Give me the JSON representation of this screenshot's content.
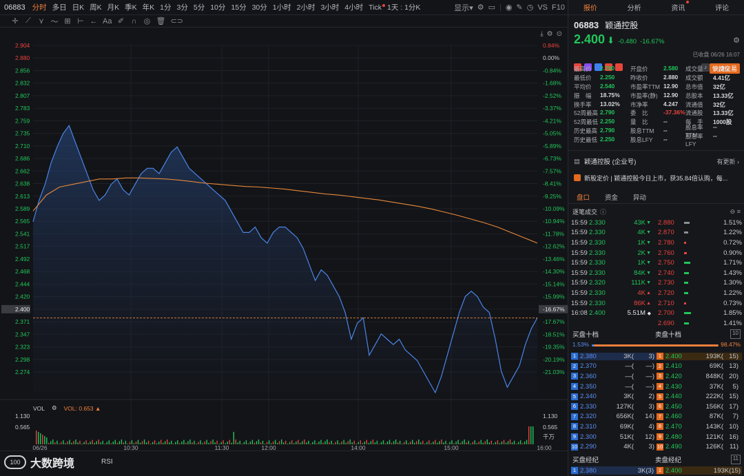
{
  "toolbar": {
    "code": "06883",
    "periods": [
      "分时",
      "多日",
      "日K",
      "周K",
      "月K",
      "季K",
      "年K",
      "1分",
      "3分",
      "5分",
      "10分",
      "15分",
      "30分",
      "1小时",
      "2小时",
      "3小时",
      "4小时",
      "Tick",
      "1天 : 1分K"
    ],
    "active_period": "分时",
    "display_label": "显示",
    "vs_label": "VS",
    "f10_label": "F10",
    "drop_arrow": "▾"
  },
  "chart_data": {
    "type": "line",
    "y_price_ticks": [
      "2.904",
      "2.880",
      "2.856",
      "2.832",
      "2.807",
      "2.783",
      "2.759",
      "2.735",
      "2.710",
      "2.686",
      "2.662",
      "2.638",
      "2.613",
      "2.589",
      "2.565",
      "2.541",
      "2.517",
      "2.492",
      "2.468",
      "2.444",
      "2.420",
      "2.400",
      "2.371",
      "2.347",
      "2.323",
      "2.298",
      "2.274"
    ],
    "y_pct_ticks": [
      "0.84%",
      "0.00%",
      "-0.84%",
      "-1.68%",
      "-2.52%",
      "-3.37%",
      "-4.21%",
      "-5.05%",
      "-5.89%",
      "-6.73%",
      "-7.57%",
      "-8.41%",
      "-9.25%",
      "-10.09%",
      "-10.94%",
      "-11.78%",
      "-12.62%",
      "-13.46%",
      "-14.30%",
      "-15.14%",
      "-15.99%",
      "-16.67%",
      "-17.67%",
      "-18.51%",
      "-19.35%",
      "-20.19%",
      "-21.03%"
    ],
    "ylim": [
      2.26,
      2.91
    ],
    "prev_close": 2.88,
    "last_price": 2.4,
    "x_labels": [
      "06/26",
      "10:30",
      "11:30",
      "12:00",
      "14:00",
      "15:00",
      "16:00"
    ],
    "series": [
      {
        "values": [
          2.58,
          2.62,
          2.65,
          2.69,
          2.72,
          2.745,
          2.76,
          2.73,
          2.7,
          2.67,
          2.64,
          2.62,
          2.63,
          2.65,
          2.66,
          2.64,
          2.63,
          2.65,
          2.67,
          2.68,
          2.68,
          2.67,
          2.69,
          2.71,
          2.72,
          2.7,
          2.68,
          2.67,
          2.66,
          2.65,
          2.64,
          2.63,
          2.62,
          2.6,
          2.58,
          2.56,
          2.56,
          2.57,
          2.55,
          2.54,
          2.56,
          2.57,
          2.57,
          2.56,
          2.55,
          2.53,
          2.5,
          2.47,
          2.49,
          2.48,
          2.46,
          2.44,
          2.41,
          2.36,
          2.39,
          2.4,
          2.33,
          2.35,
          2.37,
          2.36,
          2.35,
          2.36,
          2.34,
          2.33,
          2.32,
          2.3,
          2.28,
          2.26,
          2.29,
          2.33,
          2.37,
          2.41,
          2.44,
          2.45,
          2.44,
          2.42,
          2.41,
          2.36,
          2.3,
          2.27,
          2.29,
          2.31,
          2.35,
          2.38,
          2.4
        ]
      },
      {
        "values": [
          2.6,
          2.63,
          2.645,
          2.65,
          2.655,
          2.66,
          2.66,
          2.662,
          2.662,
          2.661,
          2.66,
          2.658,
          2.655,
          2.652,
          2.65,
          2.648,
          2.646,
          2.645,
          2.643,
          2.641,
          2.638,
          2.635,
          2.632,
          2.63,
          2.627,
          2.624,
          2.621,
          2.617,
          2.613,
          2.609,
          2.604,
          2.598,
          2.592,
          2.585,
          2.578,
          2.57,
          2.56,
          2.55,
          2.54
        ]
      }
    ],
    "vol_ticks": [
      "1.130",
      "0.565"
    ],
    "vol_unit": "千万"
  },
  "toolbar2_icons": [
    "crosshair-icon",
    "line-tool-icon",
    "fork-icon",
    "wave-icon",
    "pattern-icon",
    "measure-icon",
    "arrow-icon",
    "text-icon",
    "brush-icon",
    "magnet-icon",
    "eye-icon",
    "delete-icon",
    "capsule-icon"
  ],
  "chart_overlay": {
    "fit_icon": "⤓",
    "gear": "⚙",
    "zoom": "⊙"
  },
  "vol_legend": {
    "label": "VOL",
    "value": "VOL: 0.653",
    "arrow": "▲",
    "gear": "⚙"
  },
  "rsi": {
    "label": "RSI",
    "logo": "大数跨境"
  },
  "panel": {
    "tabs": [
      "报价",
      "分析",
      "资讯",
      "评论"
    ],
    "active_tab": "报价",
    "code": "06883",
    "name": "颖通控股",
    "price": "2.400",
    "arrow": "⬇",
    "change": "-0.480",
    "change_pct": "-16.67%",
    "closed": "已收盘 06/26 16:07",
    "fast_trade": "快捷交易",
    "badge_colors": [
      "#e9443c",
      "#8a4cf0",
      "#3f7ef0",
      "#e9443c",
      "#e9443c"
    ],
    "stats": [
      [
        [
          "最高价",
          "2.790",
          "g"
        ],
        [
          "开盘价",
          "2.580",
          "g"
        ],
        [
          "成交量",
          "1.74亿",
          ""
        ]
      ],
      [
        [
          "最低价",
          "2.250",
          "g"
        ],
        [
          "昨收价",
          "2.880",
          ""
        ],
        [
          "成交额",
          "4.41亿",
          ""
        ]
      ],
      [
        [
          "平均价",
          "2.540",
          "g"
        ],
        [
          "市盈率TTM",
          "12.90",
          ""
        ],
        [
          "总市值",
          "32亿",
          ""
        ]
      ],
      [
        [
          "振　幅",
          "18.75%",
          ""
        ],
        [
          "市盈率(静)",
          "12.90",
          ""
        ],
        [
          "总股本",
          "13.33亿",
          ""
        ]
      ],
      [
        [
          "换手率",
          "13.02%",
          ""
        ],
        [
          "市净率",
          "4.247",
          ""
        ],
        [
          "流通值",
          "32亿",
          ""
        ]
      ],
      [
        [
          "52周最高",
          "2.790",
          "g"
        ],
        [
          "委　比",
          "-37.36%",
          "r"
        ],
        [
          "流通股",
          "13.33亿",
          ""
        ]
      ],
      [
        [
          "52周最低",
          "2.250",
          "g"
        ],
        [
          "量　比",
          "--",
          ""
        ],
        [
          "每　手",
          "1000股",
          ""
        ]
      ],
      [
        [
          "历史最高",
          "2.790",
          "g"
        ],
        [
          "股息TTM",
          "--",
          ""
        ],
        [
          "股息率TTM",
          "--",
          ""
        ]
      ],
      [
        [
          "历史最低",
          "2.250",
          "g"
        ],
        [
          "股息LFY",
          "--",
          ""
        ],
        [
          "股息率LFY",
          "--",
          ""
        ]
      ]
    ],
    "news1": {
      "text": "颖通控股 (企业号)",
      "more": "有更新 ›"
    },
    "news2": {
      "text": "新股定价 | 颖通控股今日上市，获35.84倍认购，每..."
    },
    "subtabs": [
      "盘口",
      "资金",
      "异动"
    ],
    "tick_head": "逐笔成交",
    "ticks": [
      [
        "15:59",
        "2.330",
        "43K",
        "▼",
        "#21c65a"
      ],
      [
        "15:59",
        "2.330",
        "4K",
        "▼",
        "#21c65a"
      ],
      [
        "15:59",
        "2.330",
        "1K",
        "▼",
        "#21c65a"
      ],
      [
        "15:59",
        "2.330",
        "2K",
        "▼",
        "#21c65a"
      ],
      [
        "15:59",
        "2.330",
        "1K",
        "▼",
        "#21c65a"
      ],
      [
        "15:59",
        "2.330",
        "84K",
        "▼",
        "#21c65a"
      ],
      [
        "15:59",
        "2.320",
        "111K",
        "▼",
        "#21c65a"
      ],
      [
        "15:59",
        "2.330",
        "4K",
        "▲",
        "#e9443c"
      ],
      [
        "15:59",
        "2.330",
        "86K",
        "▲",
        "#e9443c"
      ],
      [
        "16:08",
        "2.400",
        "5.51M",
        "◆",
        "#e6e6e8"
      ]
    ],
    "depth": [
      [
        "2.880",
        "1.51%",
        8,
        "#8d9095"
      ],
      [
        "2.870",
        "1.22%",
        6,
        "#8d9095"
      ],
      [
        "2.780",
        "0.72%",
        3,
        "#e9443c"
      ],
      [
        "2.760",
        "0.90%",
        4,
        "#e9443c"
      ],
      [
        "2.750",
        "1.71%",
        9,
        "#21c65a"
      ],
      [
        "2.740",
        "1.43%",
        7,
        "#21c65a"
      ],
      [
        "2.730",
        "1.30%",
        6,
        "#21c65a"
      ],
      [
        "2.720",
        "1.22%",
        6,
        "#21c65a"
      ],
      [
        "2.710",
        "0.73%",
        3,
        "#e9443c"
      ],
      [
        "2.700",
        "1.85%",
        10,
        "#21c65a"
      ],
      [
        "2.690",
        "1.41%",
        7,
        "#21c65a"
      ]
    ],
    "ob_head": {
      "bid": "买盘十档",
      "ask": "卖盘十档",
      "n": "10"
    },
    "ratio": {
      "bid": "1.53%",
      "ask": "98.47%",
      "bid_fraction": 0.0153
    },
    "orderbook": [
      [
        "1",
        "2.380",
        "3K(",
        "3)",
        "1",
        "2.400",
        "193K(",
        "15)"
      ],
      [
        "2",
        "2.370",
        "—(",
        "—)",
        "2",
        "2.410",
        "69K(",
        "13)"
      ],
      [
        "3",
        "2.360",
        "—(",
        "—)",
        "3",
        "2.420",
        "848K(",
        "20)"
      ],
      [
        "4",
        "2.350",
        "—(",
        "—)",
        "4",
        "2.430",
        "37K(",
        "5)"
      ],
      [
        "5",
        "2.340",
        "3K(",
        "2)",
        "5",
        "2.440",
        "222K(",
        "15)"
      ],
      [
        "6",
        "2.330",
        "127K(",
        "3)",
        "6",
        "2.450",
        "156K(",
        "17)"
      ],
      [
        "7",
        "2.320",
        "656K(",
        "14)",
        "7",
        "2.460",
        "87K(",
        "7)"
      ],
      [
        "8",
        "2.310",
        "69K(",
        "4)",
        "8",
        "2.470",
        "143K(",
        "10)"
      ],
      [
        "9",
        "2.300",
        "51K(",
        "12)",
        "9",
        "2.480",
        "121K(",
        "16)"
      ],
      [
        "10",
        "2.290",
        "4K(",
        "3)",
        "10",
        "2.490",
        "126K(",
        "11)"
      ]
    ],
    "broker_head": {
      "bid": "买盘经纪",
      "ask": "卖盘经纪",
      "n": "11"
    },
    "broker_row": [
      "1",
      "2.380",
      "3K(3)",
      "1",
      "2.400",
      "193K(15)"
    ]
  }
}
